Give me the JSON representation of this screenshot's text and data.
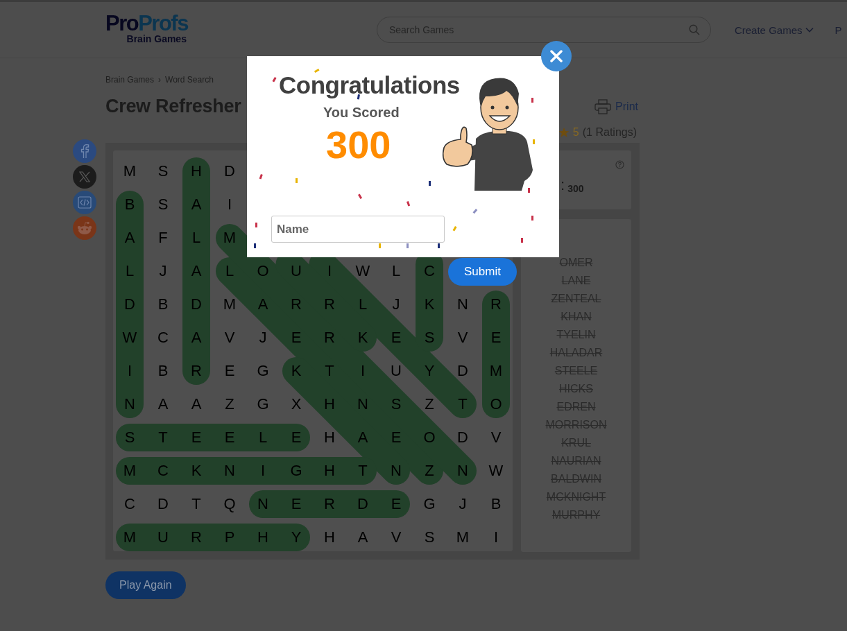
{
  "header": {
    "logo_part_1": "Pro",
    "logo_part_2": "Profs",
    "logo_tagline": "Brain Games",
    "search": {
      "placeholder": "Search Games"
    },
    "nav": [
      {
        "label": "Create Games",
        "kind": "dropdown"
      },
      {
        "label": "P",
        "kind": "link"
      }
    ]
  },
  "breadcrumb": {
    "items": [
      "Brain Games",
      "Word Search"
    ],
    "separator": "›"
  },
  "title": "Crew Refresher",
  "print": "Print",
  "rating": {
    "value": "5",
    "count": "(1 Ratings)"
  },
  "grid": {
    "rows": [
      [
        "M",
        "S",
        "H",
        "D"
      ],
      [
        "B",
        "S",
        "A",
        "I"
      ],
      [
        "A",
        "F",
        "L",
        "M"
      ],
      [
        "L",
        "J",
        "A",
        "L",
        "O",
        "U",
        "I",
        "W",
        "L",
        "C"
      ],
      [
        "D",
        "B",
        "D",
        "M",
        "A",
        "R",
        "R",
        "L",
        "J",
        "K",
        "N",
        "R"
      ],
      [
        "W",
        "C",
        "A",
        "V",
        "J",
        "E",
        "R",
        "K",
        "E",
        "S",
        "V",
        "E"
      ],
      [
        "I",
        "B",
        "R",
        "E",
        "G",
        "K",
        "T",
        "I",
        "U",
        "Y",
        "D",
        "M"
      ],
      [
        "N",
        "A",
        "A",
        "Z",
        "G",
        "X",
        "H",
        "N",
        "S",
        "Z",
        "T",
        "O"
      ],
      [
        "S",
        "T",
        "E",
        "E",
        "L",
        "E",
        "H",
        "A",
        "E",
        "O",
        "D",
        "V"
      ],
      [
        "M",
        "C",
        "K",
        "N",
        "I",
        "G",
        "H",
        "T",
        "N",
        "Z",
        "N",
        "W"
      ],
      [
        "C",
        "D",
        "T",
        "Q",
        "N",
        "E",
        "R",
        "D",
        "E",
        "G",
        "J",
        "B"
      ],
      [
        "M",
        "U",
        "R",
        "P",
        "H",
        "Y",
        "H",
        "A",
        "V",
        "S",
        "M",
        "I"
      ]
    ]
  },
  "score_card": {
    "label": ":",
    "value": "300"
  },
  "words": [
    {
      "text": "OMER",
      "found": true
    },
    {
      "text": "LANE",
      "found": true
    },
    {
      "text": "ZENTEAL",
      "found": true
    },
    {
      "text": "KHAN",
      "found": true
    },
    {
      "text": "TYELIN",
      "found": true
    },
    {
      "text": "HALADAR",
      "found": true
    },
    {
      "text": "STEELE",
      "found": true
    },
    {
      "text": "HICKS",
      "found": true
    },
    {
      "text": "EDREN",
      "found": true
    },
    {
      "text": "MORRISON",
      "found": true
    },
    {
      "text": "KRUL",
      "found": true
    },
    {
      "text": "NAURIAN",
      "found": true
    },
    {
      "text": "BALDWIN",
      "found": true
    },
    {
      "text": "MCKNIGHT",
      "found": true
    },
    {
      "text": "MURPHY",
      "found": true
    }
  ],
  "play_again": "Play Again",
  "modal": {
    "title": "Congratulations",
    "subtitle": "You Scored",
    "score": "300",
    "name_field": {
      "placeholder": "Name"
    },
    "submit": "Submit"
  }
}
